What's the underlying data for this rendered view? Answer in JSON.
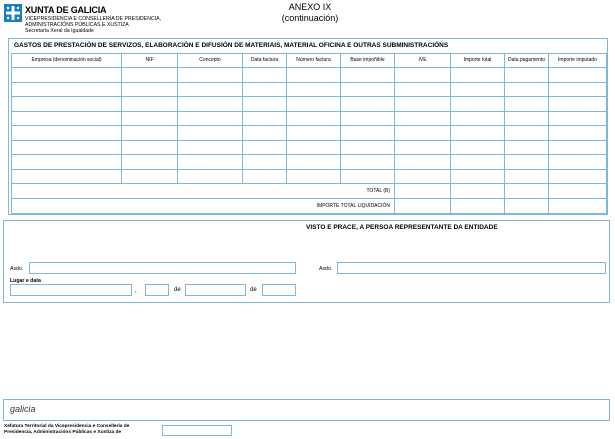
{
  "header": {
    "logo_title": "XUNTA DE GALICIA",
    "logo_lines": [
      "VICEPRESIDENCIA E CONSELLERÍA DE PRESIDENCIA,",
      "ADMINISTRACIÓNS PÚBLICAS E XUSTIZA",
      "Secretaría Xeral da Igualdade"
    ],
    "annex_title": "ANEXO IX",
    "annex_subtitle": "(continuación)"
  },
  "expenses": {
    "section_title": "GASTOS DE PRESTACIÓN DE SERVIZOS, ELABORACIÓN E DIFUSIÓN DE MATERIAIS, MATERIAL OFICINA E OUTRAS SUBMINISTRACIÓNS",
    "columns": [
      "Empresa (denominación social)",
      "NIF",
      "Concepto",
      "Data factura",
      "Número factura",
      "Base impoñible",
      "IVE",
      "Importe total",
      "Data pagamento",
      "Importe imputado"
    ],
    "rows": [
      [
        "",
        "",
        "",
        "",
        "",
        "",
        "",
        "",
        "",
        ""
      ],
      [
        "",
        "",
        "",
        "",
        "",
        "",
        "",
        "",
        "",
        ""
      ],
      [
        "",
        "",
        "",
        "",
        "",
        "",
        "",
        "",
        "",
        ""
      ],
      [
        "",
        "",
        "",
        "",
        "",
        "",
        "",
        "",
        "",
        ""
      ],
      [
        "",
        "",
        "",
        "",
        "",
        "",
        "",
        "",
        "",
        ""
      ],
      [
        "",
        "",
        "",
        "",
        "",
        "",
        "",
        "",
        "",
        ""
      ],
      [
        "",
        "",
        "",
        "",
        "",
        "",
        "",
        "",
        "",
        ""
      ],
      [
        "",
        "",
        "",
        "",
        "",
        "",
        "",
        "",
        "",
        ""
      ]
    ],
    "total_label": "TOTAL (B)",
    "liquidation_label": "IMPORTE TOTAL LIQUIDACIÓN"
  },
  "signature": {
    "title": "VISTO E PRACE, A PERSOA REPRESENTANTE DA ENTIDADE",
    "asdo_left_label": "Asdo.",
    "asdo_right_label": "Asdo.",
    "place_date_label": "Lugar e data",
    "comma": ",",
    "de_1": "de",
    "de_2": "de"
  },
  "footer": {
    "logo_text": "galicia",
    "department_lines": [
      "Xefatura Territorial da Vicepresidencia e Consellería de",
      "Presidencia, Administracións Públicas e Xustiza de"
    ]
  }
}
